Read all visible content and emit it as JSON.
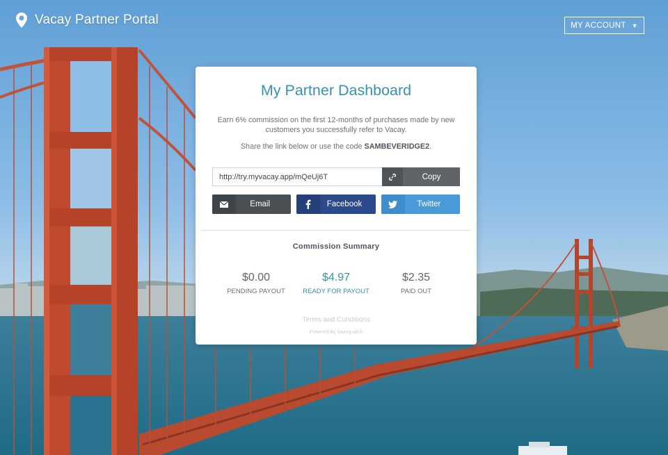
{
  "header": {
    "brand_name": "Vacay Partner Portal",
    "account_button": "MY ACCOUNT",
    "account_caret": "▼"
  },
  "dashboard": {
    "title": "My Partner Dashboard",
    "description": "Earn 6% commission on the first 12-months of purchases made by new customers you successfully refer to Vacay.",
    "share_prefix": "Share the link below or use the code ",
    "referral_code": "SAMBEVERIDGE2",
    "share_suffix": ".",
    "referral_link": "http://try.myvacay.app/mQeUj6T",
    "copy_label": "Copy",
    "share_buttons": {
      "email": "Email",
      "facebook": "Facebook",
      "twitter": "Twitter"
    },
    "summary_title": "Commission Summary",
    "stats": [
      {
        "amount": "$0.00",
        "caption": "PENDING PAYOUT"
      },
      {
        "amount": "$4.97",
        "caption": "READY FOR PAYOUT"
      },
      {
        "amount": "$2.35",
        "caption": "PAID OUT"
      }
    ],
    "terms_link": "Terms and Conditions",
    "powered_by": "Powered By Saasquatch"
  },
  "colors": {
    "accent": "#3393b4",
    "email_button": "#4a4f53",
    "facebook_button": "#2c4a8a",
    "twitter_button": "#4a9ad8",
    "copy_button": "#5e6468"
  },
  "icons": {
    "brand": "map-pin-icon",
    "copy": "link-icon",
    "email": "envelope-icon",
    "facebook": "facebook-icon",
    "twitter": "twitter-bird-icon"
  }
}
